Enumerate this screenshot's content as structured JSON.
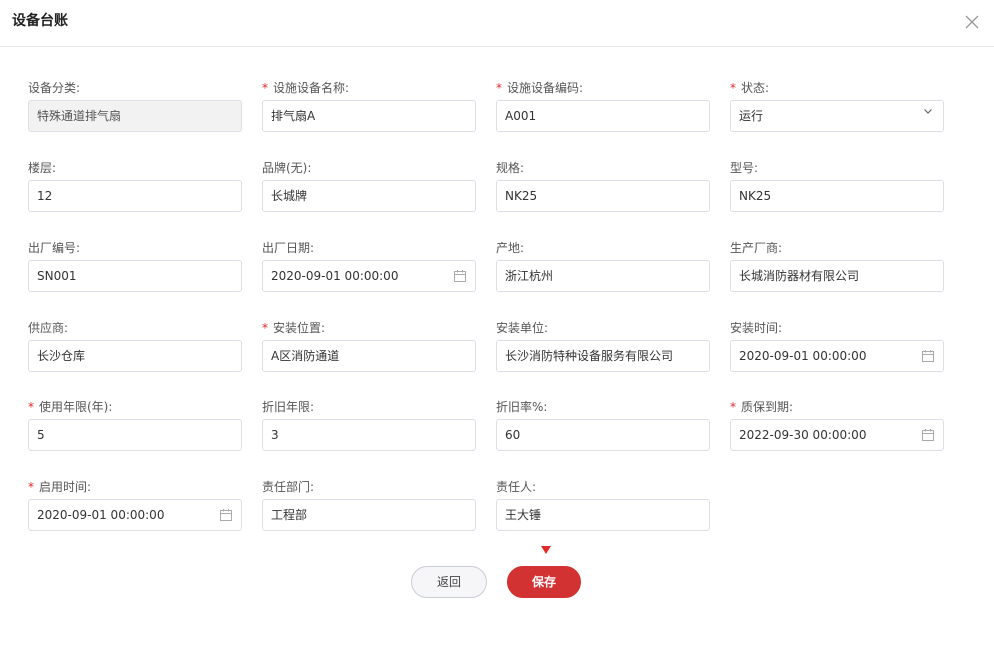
{
  "dialog": {
    "title": "设备台账"
  },
  "form": {
    "fields": [
      {
        "label": "设备分类:",
        "value": "特殊通道排气扇",
        "required": false,
        "type": "disabled"
      },
      {
        "label": "设施设备名称:",
        "value": "排气扇A",
        "required": true,
        "type": "text"
      },
      {
        "label": "设施设备编码:",
        "value": "A001",
        "required": true,
        "type": "text"
      },
      {
        "label": "状态:",
        "value": "运行",
        "required": true,
        "type": "select"
      },
      {
        "label": "楼层:",
        "value": "12",
        "required": false,
        "type": "text"
      },
      {
        "label": "品牌(无):",
        "value": "长城牌",
        "required": false,
        "type": "text"
      },
      {
        "label": "规格:",
        "value": "NK25",
        "required": false,
        "type": "text"
      },
      {
        "label": "型号:",
        "value": "NK25",
        "required": false,
        "type": "text"
      },
      {
        "label": "出厂编号:",
        "value": "SN001",
        "required": false,
        "type": "text"
      },
      {
        "label": "出厂日期:",
        "value": "2020-09-01 00:00:00",
        "required": false,
        "type": "date"
      },
      {
        "label": "产地:",
        "value": "浙江杭州",
        "required": false,
        "type": "text"
      },
      {
        "label": "生产厂商:",
        "value": "长城消防器材有限公司",
        "required": false,
        "type": "text"
      },
      {
        "label": "供应商:",
        "value": "长沙仓库",
        "required": false,
        "type": "text"
      },
      {
        "label": "安装位置:",
        "value": "A区消防通道",
        "required": true,
        "type": "text"
      },
      {
        "label": "安装单位:",
        "value": "长沙消防特种设备服务有限公司",
        "required": false,
        "type": "text"
      },
      {
        "label": "安装时间:",
        "value": "2020-09-01 00:00:00",
        "required": false,
        "type": "date"
      },
      {
        "label": "使用年限(年):",
        "value": "5",
        "required": true,
        "type": "text"
      },
      {
        "label": "折旧年限:",
        "value": "3",
        "required": false,
        "type": "text"
      },
      {
        "label": "折旧率%:",
        "value": "60",
        "required": false,
        "type": "text"
      },
      {
        "label": "质保到期:",
        "value": "2022-09-30 00:00:00",
        "required": true,
        "type": "date"
      },
      {
        "label": "启用时间:",
        "value": "2020-09-01 00:00:00",
        "required": true,
        "type": "date"
      },
      {
        "label": "责任部门:",
        "value": "工程部",
        "required": false,
        "type": "text"
      },
      {
        "label": "责任人:",
        "value": "王大锤",
        "required": false,
        "type": "text"
      }
    ]
  },
  "actions": {
    "back_label": "返回",
    "save_label": "保存"
  },
  "colors": {
    "required": "#e02b2b",
    "primary": "#d23232",
    "border": "#dcdfe6"
  },
  "icons": {
    "close": "close-icon",
    "calendar": "calendar-icon",
    "dropdown": "chevron-down-icon",
    "pointer": "arrow-pointer-icon"
  }
}
